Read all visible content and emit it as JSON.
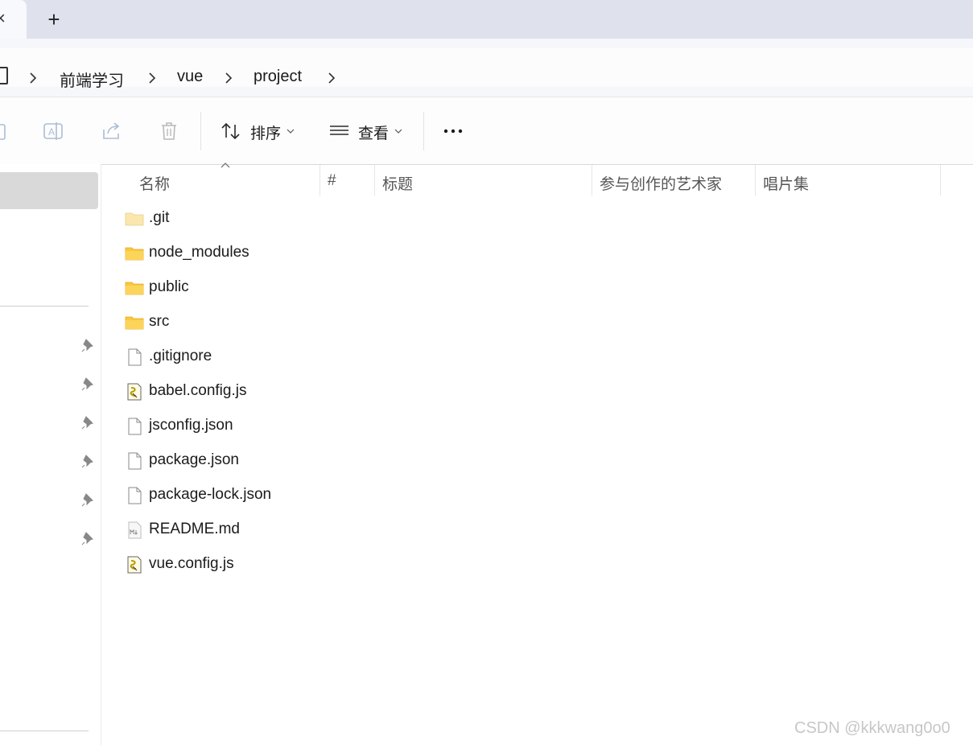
{
  "tabs": {
    "new_tab_label": "+",
    "close_label": "×"
  },
  "breadcrumb": [
    "前端学习",
    "vue",
    "project"
  ],
  "toolbar": {
    "sort_label": "排序",
    "view_label": "查看",
    "more_label": "..."
  },
  "columns": [
    "名称",
    "#",
    "标题",
    "参与创作的艺术家",
    "唱片集"
  ],
  "files": [
    {
      "name": ".git",
      "type": "folder-light-icon"
    },
    {
      "name": "node_modules",
      "type": "folder-icon"
    },
    {
      "name": "public",
      "type": "folder-icon"
    },
    {
      "name": "src",
      "type": "folder-icon"
    },
    {
      "name": ".gitignore",
      "type": "file-icon"
    },
    {
      "name": "babel.config.js",
      "type": "js-file-icon"
    },
    {
      "name": "jsconfig.json",
      "type": "file-icon"
    },
    {
      "name": "package.json",
      "type": "file-icon"
    },
    {
      "name": "package-lock.json",
      "type": "file-icon"
    },
    {
      "name": "README.md",
      "type": "markdown-file-icon"
    },
    {
      "name": "vue.config.js",
      "type": "js-file-icon"
    }
  ],
  "watermark": "CSDN @kkkwang0o0"
}
